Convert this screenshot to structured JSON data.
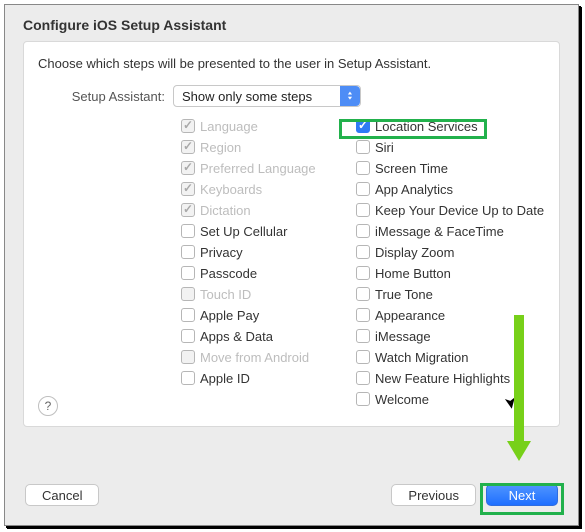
{
  "title": "Configure iOS Setup Assistant",
  "description": "Choose which steps will be presented to the user in Setup Assistant.",
  "selector": {
    "label": "Setup Assistant:",
    "value": "Show only some steps"
  },
  "left": [
    {
      "label": "Language",
      "checked": true,
      "disabled": true
    },
    {
      "label": "Region",
      "checked": true,
      "disabled": true
    },
    {
      "label": "Preferred Language",
      "checked": true,
      "disabled": true
    },
    {
      "label": "Keyboards",
      "checked": true,
      "disabled": true
    },
    {
      "label": "Dictation",
      "checked": true,
      "disabled": true
    },
    {
      "label": "Set Up Cellular",
      "checked": false,
      "disabled": false
    },
    {
      "label": "Privacy",
      "checked": false,
      "disabled": false
    },
    {
      "label": "Passcode",
      "checked": false,
      "disabled": false
    },
    {
      "label": "Touch ID",
      "checked": false,
      "disabled": true
    },
    {
      "label": "Apple Pay",
      "checked": false,
      "disabled": false
    },
    {
      "label": "Apps & Data",
      "checked": false,
      "disabled": false
    },
    {
      "label": "Move from Android",
      "checked": false,
      "disabled": true
    },
    {
      "label": "Apple ID",
      "checked": false,
      "disabled": false
    }
  ],
  "right": [
    {
      "label": "Location Services",
      "checked": true,
      "disabled": false,
      "highlight": true
    },
    {
      "label": "Siri",
      "checked": false,
      "disabled": false
    },
    {
      "label": "Screen Time",
      "checked": false,
      "disabled": false
    },
    {
      "label": "App Analytics",
      "checked": false,
      "disabled": false
    },
    {
      "label": "Keep Your Device Up to Date",
      "checked": false,
      "disabled": false
    },
    {
      "label": "iMessage & FaceTime",
      "checked": false,
      "disabled": false
    },
    {
      "label": "Display Zoom",
      "checked": false,
      "disabled": false
    },
    {
      "label": "Home Button",
      "checked": false,
      "disabled": false
    },
    {
      "label": "True Tone",
      "checked": false,
      "disabled": false
    },
    {
      "label": "Appearance",
      "checked": false,
      "disabled": false
    },
    {
      "label": "iMessage",
      "checked": false,
      "disabled": false
    },
    {
      "label": "Watch Migration",
      "checked": false,
      "disabled": false
    },
    {
      "label": "New Feature Highlights",
      "checked": false,
      "disabled": false
    },
    {
      "label": "Welcome",
      "checked": false,
      "disabled": false
    }
  ],
  "help": "?",
  "footer": {
    "cancel": "Cancel",
    "previous": "Previous",
    "next": "Next"
  },
  "colors": {
    "accent": "#2f7bf6",
    "highlight": "#22b14c",
    "arrow": "#77d019"
  }
}
